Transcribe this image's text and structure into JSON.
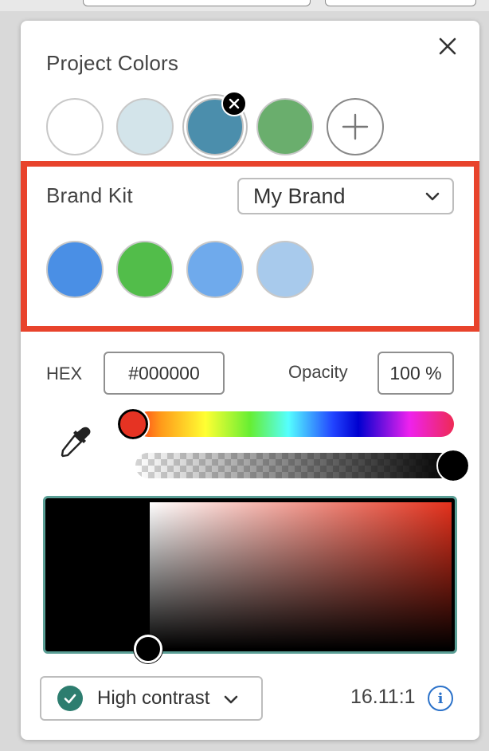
{
  "project_colors": {
    "title": "Project Colors",
    "swatches": [
      "#ffffff",
      "#d3e4ea",
      "#4b8eac",
      "#6aae6d"
    ],
    "selected_index": 2,
    "add_icon": "plus-icon",
    "remove_icon": "close-icon"
  },
  "brand_kit": {
    "title": "Brand Kit",
    "selected_kit": "My Brand",
    "swatches": [
      "#4a8fe5",
      "#52bd4a",
      "#6faaec",
      "#a8caec"
    ]
  },
  "picker": {
    "hex_label": "HEX",
    "hex_value": "#000000",
    "opacity_label": "Opacity",
    "opacity_value": "100 %",
    "hue_thumb_color": "#e63323",
    "alpha_thumb_color": "#000000",
    "current_color": "#000000",
    "base_hue_color": "#e4311c"
  },
  "contrast": {
    "label": "High contrast",
    "ratio": "16.11:1",
    "badge_color": "#2d7d6f"
  },
  "colors": {
    "highlight_border": "#e8432c",
    "sv_border": "#5a9e95",
    "info_blue": "#2a71c9"
  }
}
